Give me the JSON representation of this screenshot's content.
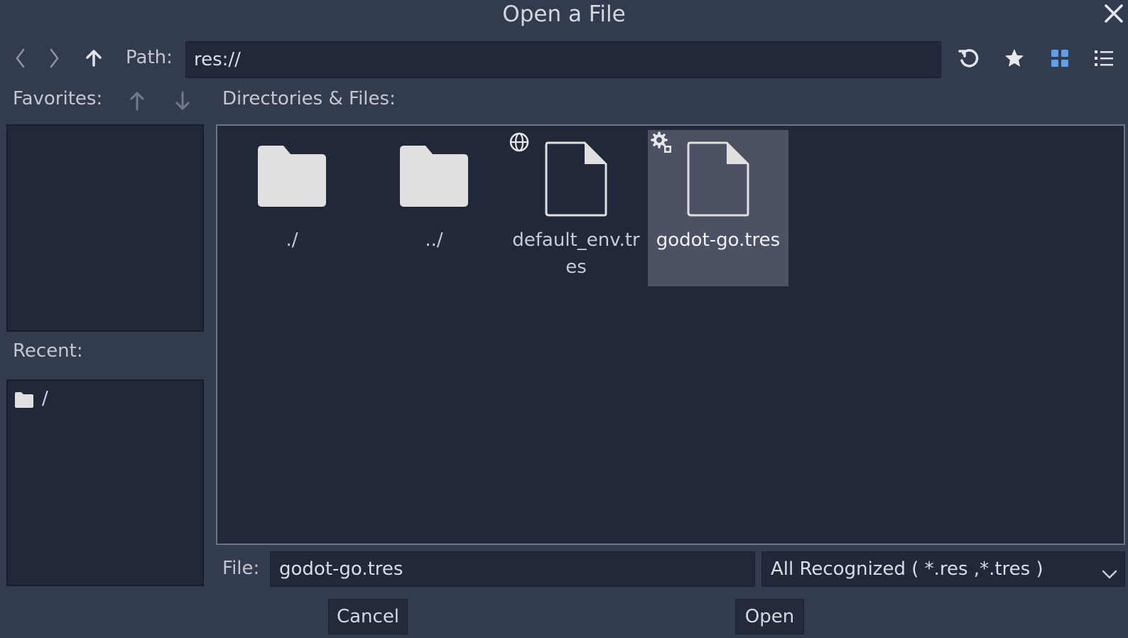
{
  "window": {
    "title": "Open a File"
  },
  "toolbar": {
    "back_icon": "chevron-left-icon",
    "forward_icon": "chevron-right-icon",
    "up_icon": "arrow-up-icon",
    "path_label": "Path:",
    "path_value": "res://",
    "refresh_icon": "refresh-icon",
    "favorite_icon": "star-icon",
    "grid_view_icon": "grid-icon",
    "list_view_icon": "list-icon"
  },
  "favorites": {
    "label": "Favorites:",
    "items": []
  },
  "recent": {
    "label": "Recent:",
    "items": [
      {
        "label": "/",
        "icon": "folder-icon"
      }
    ]
  },
  "files": {
    "label": "Directories & Files:",
    "items": [
      {
        "name": "./",
        "type": "folder"
      },
      {
        "name": "../",
        "type": "folder"
      },
      {
        "name": "default_env.tres",
        "type": "file",
        "badge": "globe-icon"
      },
      {
        "name": "godot-go.tres",
        "type": "file",
        "badge": "resource-icon",
        "selected": true
      }
    ]
  },
  "footer": {
    "file_label": "File:",
    "file_value": "godot-go.tres",
    "filter_value": "All Recognized ( *.res ,*.tres  )",
    "cancel_label": "Cancel",
    "open_label": "Open"
  },
  "colors": {
    "background": "#333b4f",
    "panel": "#21283a",
    "selection": "#4c5263",
    "accent": "#5f9ee8",
    "icon": "#e0e0e0"
  }
}
